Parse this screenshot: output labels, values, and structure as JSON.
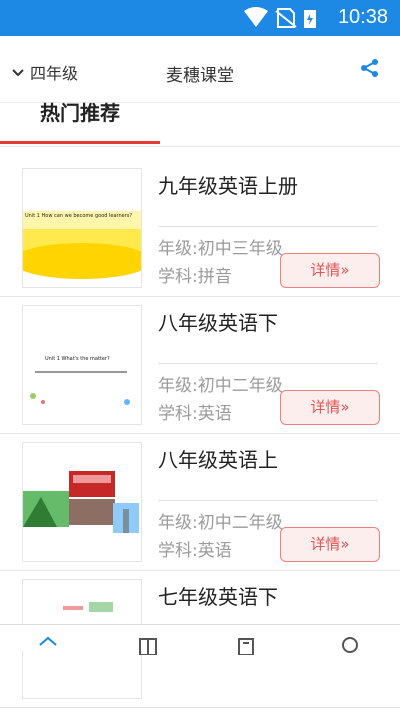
{
  "status": {
    "time": "10:38"
  },
  "header": {
    "grade_selector": "四年级",
    "title": "麦穗课堂"
  },
  "tabs": [
    {
      "label": "热门推荐"
    }
  ],
  "items": [
    {
      "title": "九年级英语上册",
      "grade": "年级:初中三年级",
      "subject": "学科:拼音",
      "detail": "详情»",
      "thumb_text": "Unit 1  How can we become good learners?"
    },
    {
      "title": "八年级英语下",
      "grade": "年级:初中二年级",
      "subject": "学科:英语",
      "detail": "详情»",
      "thumb_text": "Unit 1  What's the matter?"
    },
    {
      "title": "八年级英语上",
      "grade": "年级:初中二年级",
      "subject": "学科:英语",
      "detail": "详情»",
      "thumb_text": ""
    },
    {
      "title": "七年级英语下",
      "grade": "",
      "subject": "",
      "detail": "",
      "thumb_text": ""
    }
  ],
  "colors": {
    "statusbar": "#1e88e5",
    "accent_red": "#e53935",
    "detail_border": "#f08080"
  },
  "icons": [
    "wifi-icon",
    "no-sim-icon",
    "battery-icon",
    "chevron-down-icon",
    "share-icon",
    "home-icon",
    "book-icon",
    "list-icon",
    "user-icon"
  ]
}
